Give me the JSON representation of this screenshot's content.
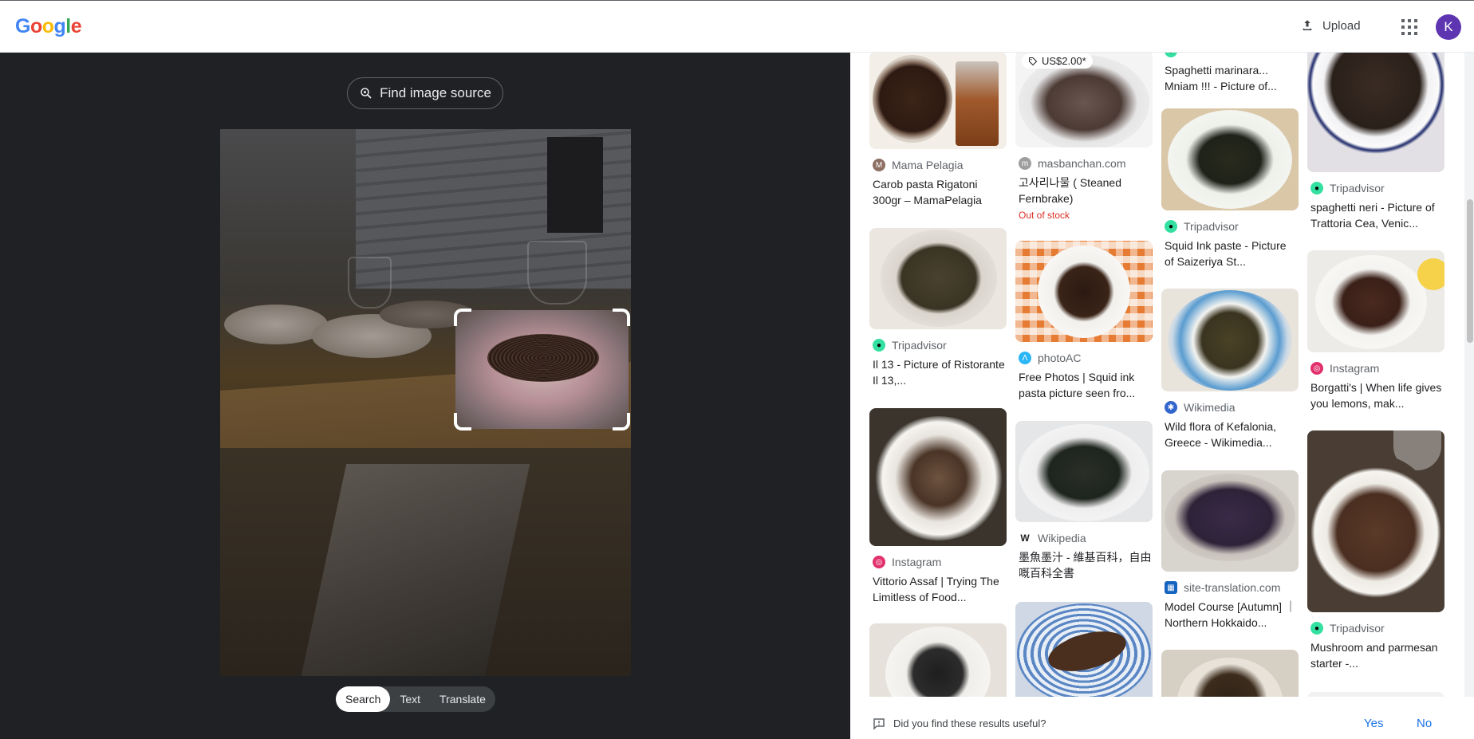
{
  "header": {
    "logo": [
      "G",
      "o",
      "o",
      "g",
      "l",
      "e"
    ],
    "logo_colors": [
      "#4285f4",
      "#ea4335",
      "#fbbc05",
      "#4285f4",
      "#34a853",
      "#ea4335"
    ],
    "upload_label": "Upload",
    "avatar_letter": "K"
  },
  "lens": {
    "find_source_label": "Find image source",
    "modes": [
      "Search",
      "Text",
      "Translate"
    ],
    "active_mode": "Search"
  },
  "results": {
    "col1": [
      {
        "source": "Mama Pelagia",
        "title": "Carob pasta Rigatoni 300gr – MamaPelagia",
        "fav_color": "#8d6e63",
        "fav_icon": "mama-pelagia-icon"
      },
      {
        "source": "Tripadvisor",
        "title": "Il 13 - Picture of Ristorante Il 13,...",
        "fav_color": "#34e0a1",
        "fav_icon": "tripadvisor-icon"
      },
      {
        "source": "Instagram",
        "title": "Vittorio Assaf | Trying The Limitless of Food...",
        "fav_color": "#e1306c",
        "fav_icon": "instagram-icon"
      },
      {
        "source": "",
        "title": "",
        "fav_color": "#ffffff",
        "fav_icon": ""
      }
    ],
    "col2": [
      {
        "price": "US$2.00*",
        "source": "masbanchan.com",
        "title": "고사리나물 ( Steaned Fernbrake)",
        "out_of_stock": "Out of stock",
        "fav_color": "#9e9e9e",
        "fav_icon": "masbanchan-icon"
      },
      {
        "source": "photoAC",
        "title": "Free Photos | Squid ink pasta picture seen fro...",
        "fav_color": "#29b6f6",
        "fav_icon": "photoac-icon"
      },
      {
        "source": "Wikipedia",
        "title": "墨魚墨汁 - 維基百科，自由嘅百科全書",
        "fav_color": "#ffffff",
        "fav_icon": "wikipedia-icon"
      },
      {
        "source": "",
        "title": "",
        "fav_color": "#ffffff",
        "fav_icon": ""
      }
    ],
    "col3": [
      {
        "source": "",
        "title": "Spaghetti marinara... Mniam !!! - Picture of...",
        "fav_color": "#34e0a1",
        "fav_icon": "tripadvisor-icon"
      },
      {
        "source": "Tripadvisor",
        "title": "Squid Ink paste - Picture of Saizeriya St...",
        "fav_color": "#34e0a1",
        "fav_icon": "tripadvisor-icon"
      },
      {
        "source": "Wikimedia",
        "title": "Wild flora of Kefalonia, Greece - Wikimedia...",
        "fav_color": "#3366cc",
        "fav_icon": "wikimedia-icon"
      },
      {
        "source": "site-translation.com",
        "title": "Model Course [Autumn] ｜Northern Hokkaido...",
        "fav_color": "#1565c0",
        "fav_icon": "site-translation-icon"
      },
      {
        "source": "",
        "title": "",
        "fav_color": "#ffffff",
        "fav_icon": ""
      }
    ],
    "col4": [
      {
        "source": "Tripadvisor",
        "title": "spaghetti neri - Picture of Trattoria Cea, Venic...",
        "fav_color": "#34e0a1",
        "fav_icon": "tripadvisor-icon"
      },
      {
        "source": "Instagram",
        "title": "Borgatti's | When life gives you lemons, mak...",
        "fav_color": "#e1306c",
        "fav_icon": "instagram-icon"
      },
      {
        "source": "Tripadvisor",
        "title": "Mushroom and parmesan starter -...",
        "fav_color": "#34e0a1",
        "fav_icon": "tripadvisor-icon"
      },
      {
        "source": "",
        "title": "",
        "fav_color": "#ffffff",
        "fav_icon": ""
      }
    ]
  },
  "feedback": {
    "question": "Did you find these results useful?",
    "yes": "Yes",
    "no": "No"
  },
  "colors": {
    "dark_bg": "#202124",
    "link_blue": "#1a73e8",
    "out_of_stock_red": "#d93025"
  }
}
